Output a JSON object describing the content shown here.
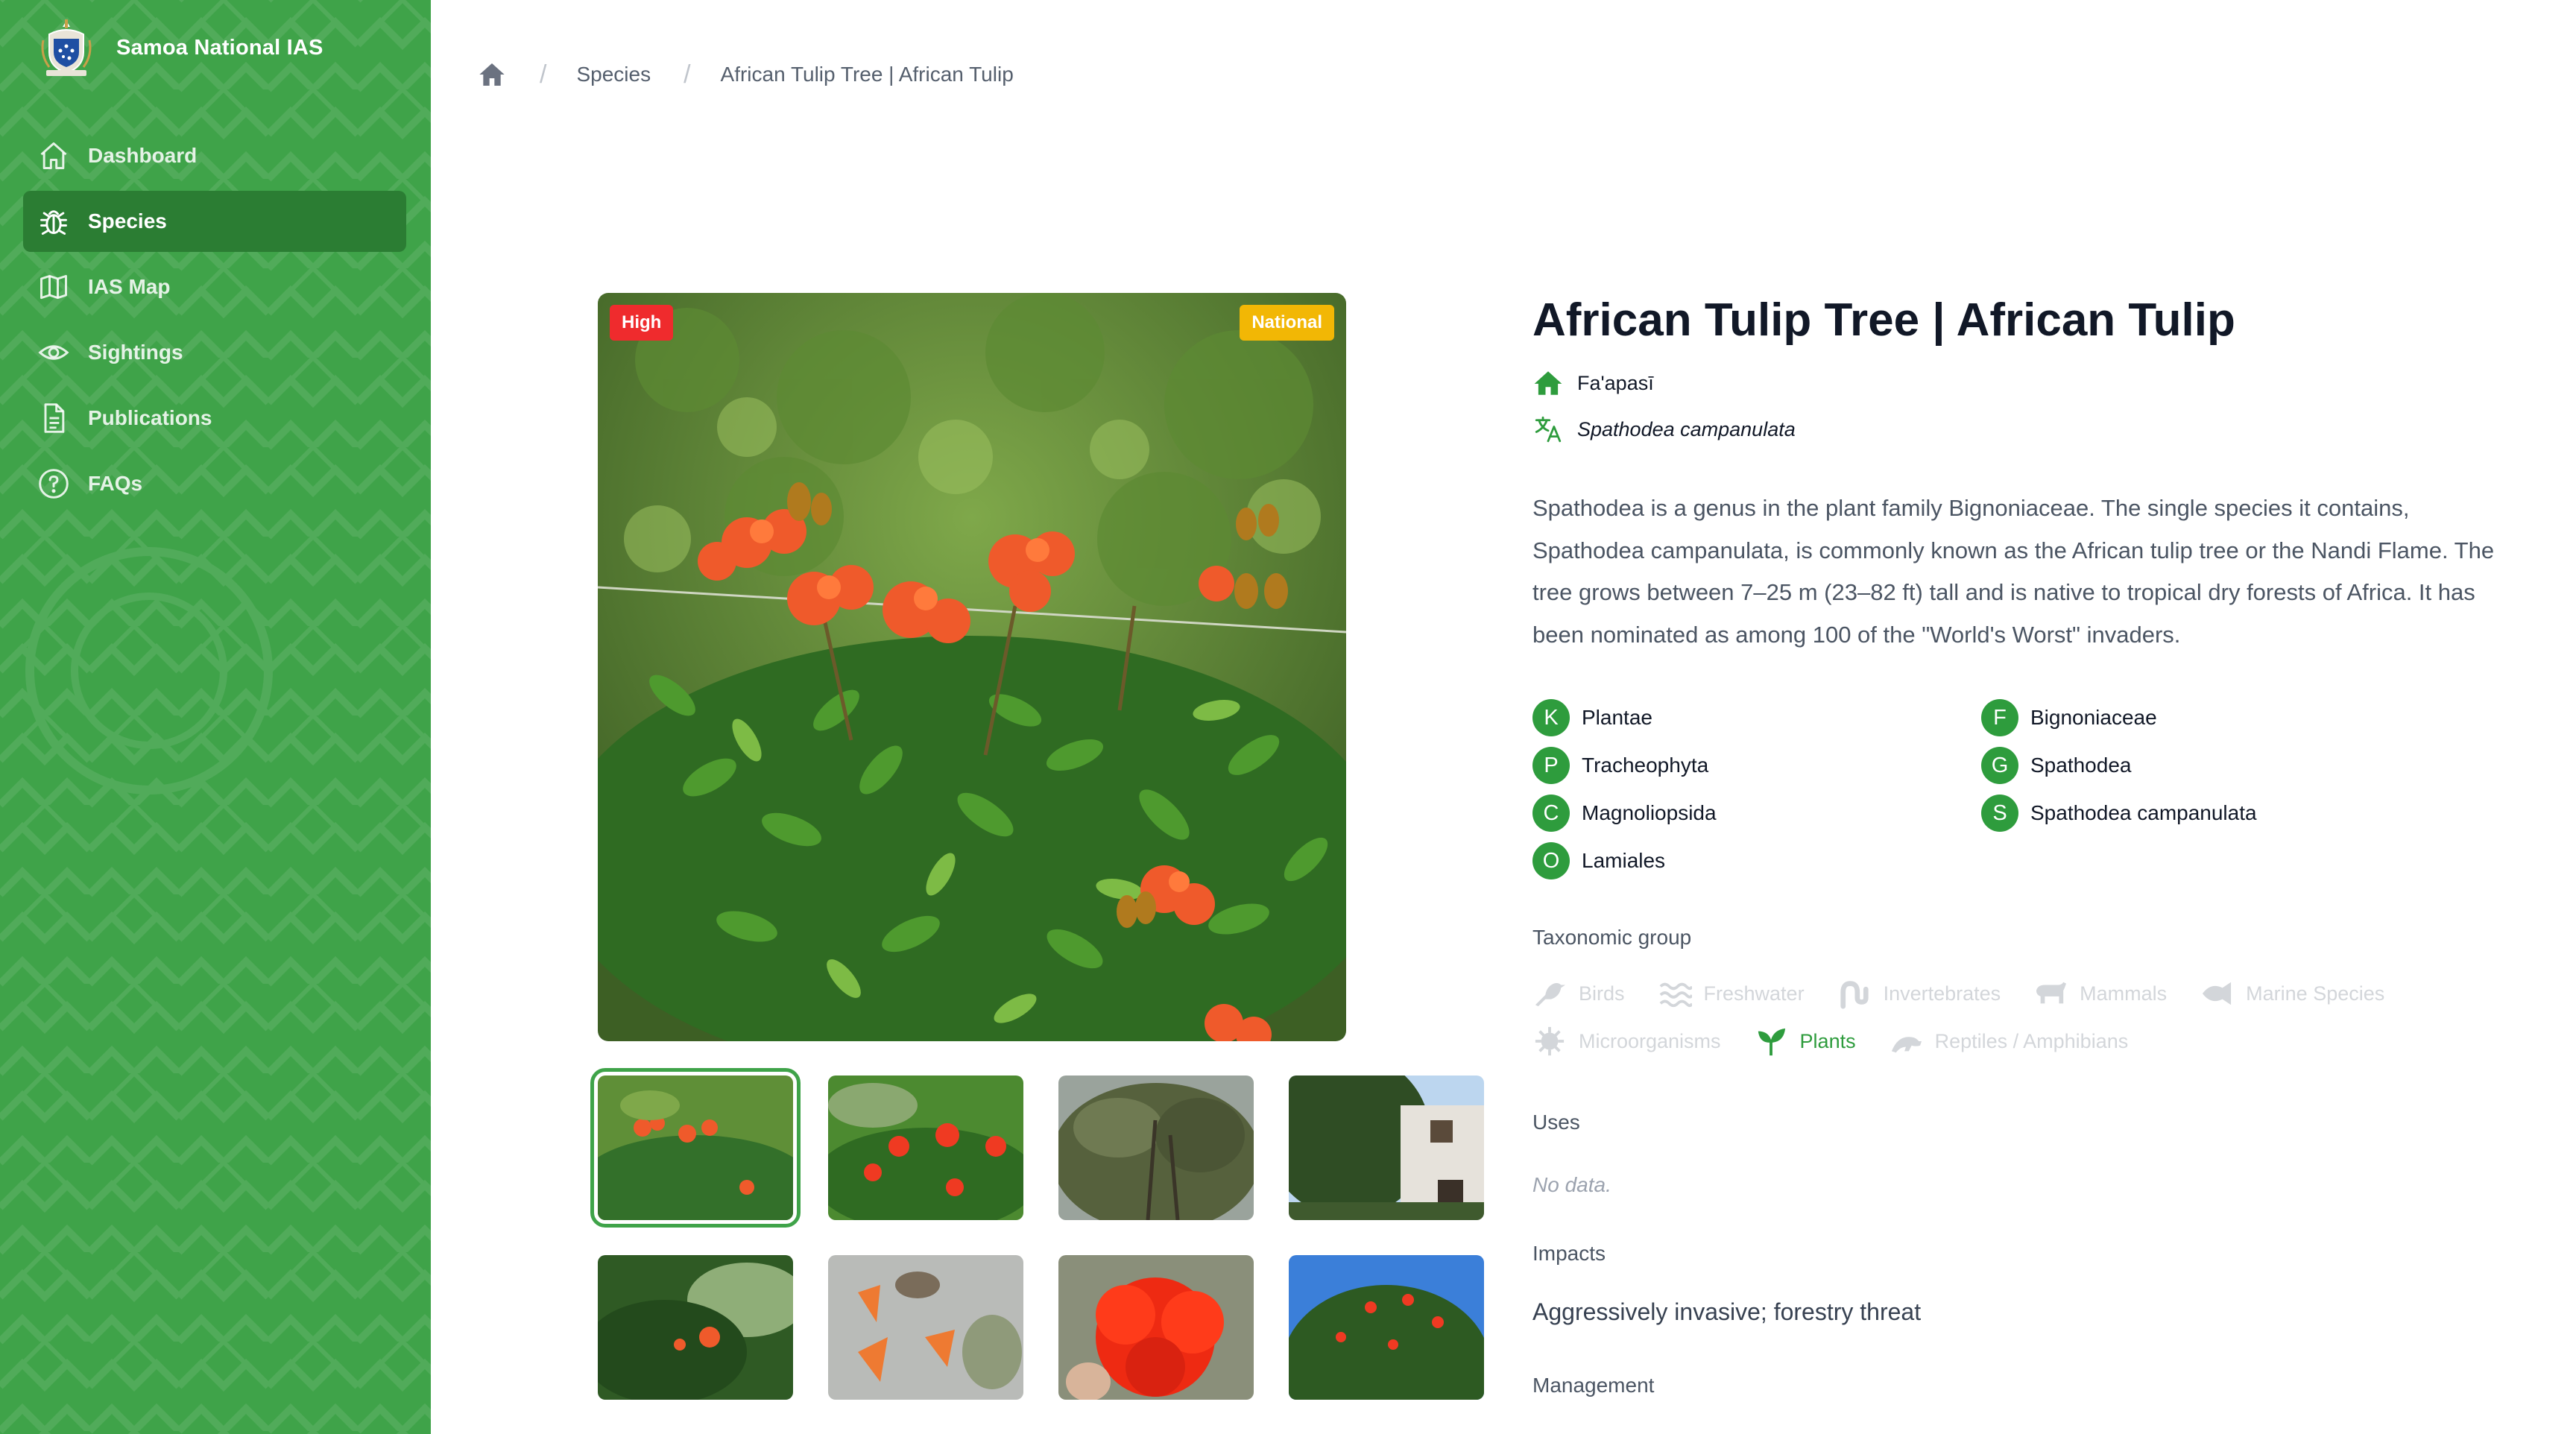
{
  "app": {
    "name": "Samoa National IAS"
  },
  "sidebar": {
    "items": [
      {
        "label": "Dashboard",
        "icon": "home-icon",
        "active": false
      },
      {
        "label": "Species",
        "icon": "bug-icon",
        "active": true
      },
      {
        "label": "IAS Map",
        "icon": "map-icon",
        "active": false
      },
      {
        "label": "Sightings",
        "icon": "eye-icon",
        "active": false
      },
      {
        "label": "Publications",
        "icon": "document-icon",
        "active": false
      },
      {
        "label": "FAQs",
        "icon": "help-circle-icon",
        "active": false
      }
    ]
  },
  "breadcrumb": {
    "home_icon": "home-icon",
    "items": [
      "Species",
      "African Tulip Tree | African Tulip"
    ]
  },
  "species": {
    "title": "African Tulip Tree | African Tulip",
    "local_name": "Fa'apasī",
    "scientific_name": "Spathodea campanulata",
    "badges": {
      "risk": "High",
      "scope": "National"
    },
    "description": "Spathodea is a genus in the plant family Bignoniaceae. The single species it contains, Spathodea campanulata, is commonly known as the African tulip tree or the Nandi Flame. The tree grows between 7–25 m (23–82 ft) tall and is native to tropical dry forests of Africa. It has been nominated as among 100 of the \"World's Worst\" invaders.",
    "taxonomy": [
      {
        "letter": "K",
        "value": "Plantae"
      },
      {
        "letter": "F",
        "value": "Bignoniaceae"
      },
      {
        "letter": "P",
        "value": "Tracheophyta"
      },
      {
        "letter": "G",
        "value": "Spathodea"
      },
      {
        "letter": "C",
        "value": "Magnoliopsida"
      },
      {
        "letter": "S",
        "value": "Spathodea campanulata"
      },
      {
        "letter": "O",
        "value": "Lamiales"
      }
    ],
    "taxonomic_group_label": "Taxonomic group",
    "taxonomic_groups": [
      {
        "label": "Birds",
        "icon": "bird-icon",
        "active": false
      },
      {
        "label": "Freshwater",
        "icon": "waves-icon",
        "active": false
      },
      {
        "label": "Invertebrates",
        "icon": "worm-icon",
        "active": false
      },
      {
        "label": "Mammals",
        "icon": "mammal-icon",
        "active": false
      },
      {
        "label": "Marine Species",
        "icon": "fish-icon",
        "active": false
      },
      {
        "label": "Microorganisms",
        "icon": "microbe-icon",
        "active": false
      },
      {
        "label": "Plants",
        "icon": "sprout-icon",
        "active": true
      },
      {
        "label": "Reptiles / Amphibians",
        "icon": "reptile-icon",
        "active": false
      }
    ],
    "uses_label": "Uses",
    "uses_value": "No data.",
    "impacts_label": "Impacts",
    "impacts_value": "Aggressively invasive; forestry threat",
    "management_label": "Management"
  },
  "colors": {
    "sidebar_bg": "#3fa349",
    "sidebar_active": "#2b7d33",
    "accent": "#2e9c3d",
    "badge_high": "#ef2b2d",
    "badge_national": "#f2b705"
  }
}
